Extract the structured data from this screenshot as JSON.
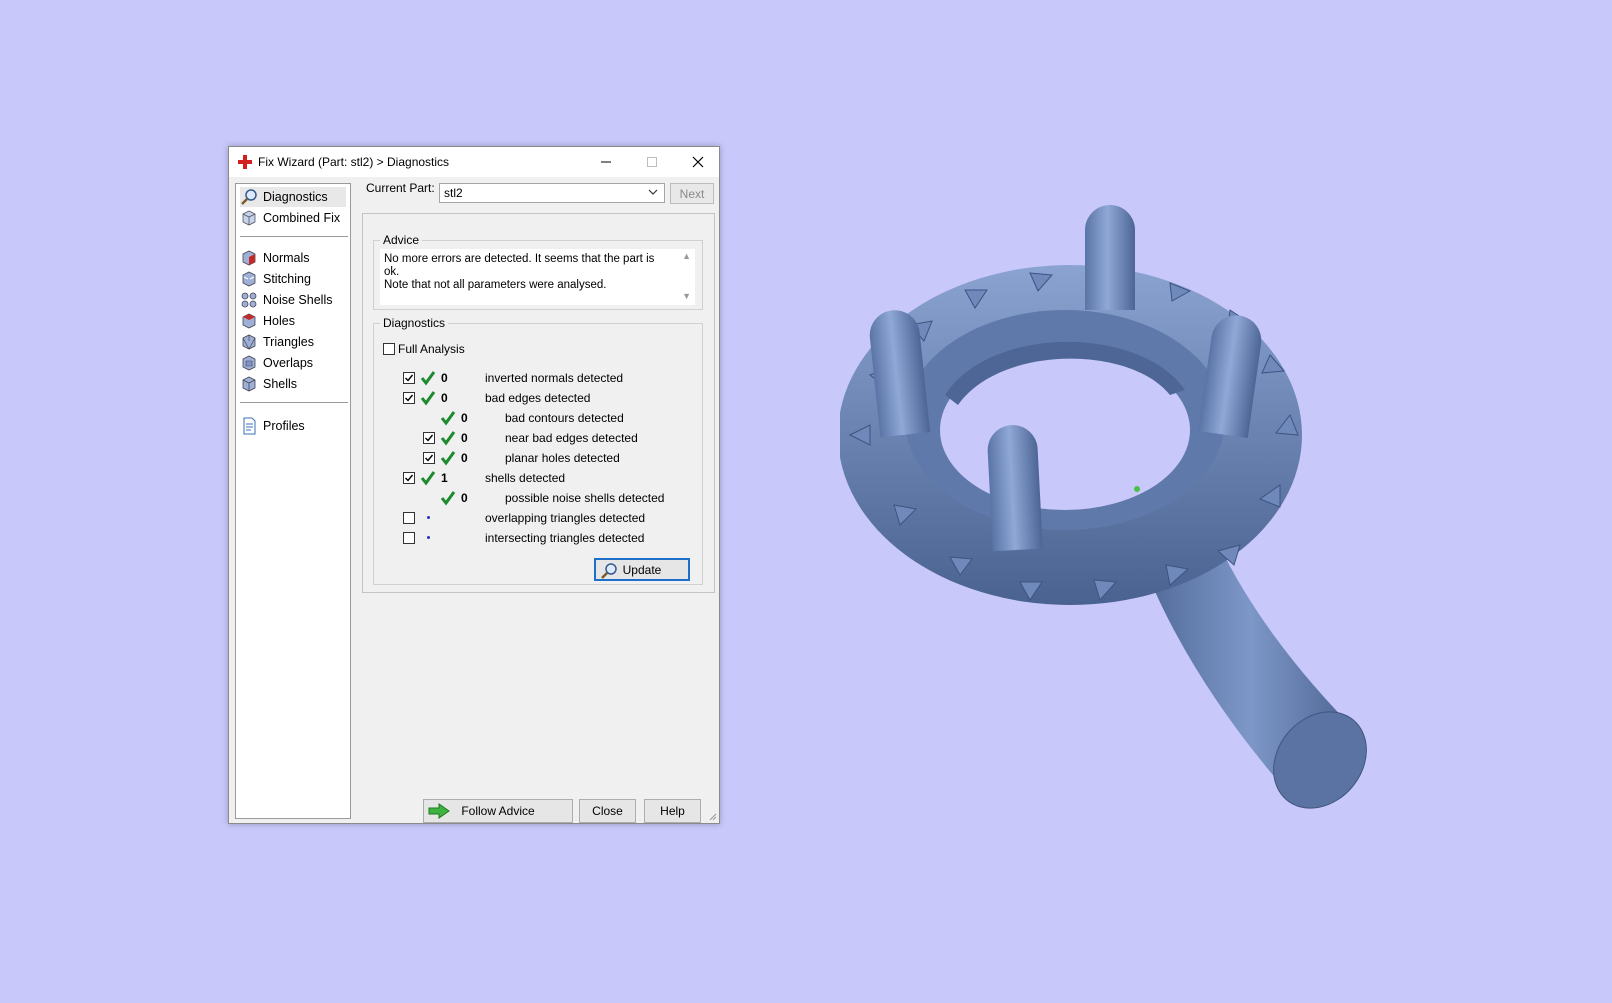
{
  "window": {
    "title": "Fix Wizard (Part: stl2) > Diagnostics"
  },
  "nav": {
    "items": [
      {
        "label": "Diagnostics",
        "icon": "magnifier-icon",
        "selected": true
      },
      {
        "label": "Combined Fix",
        "icon": "cube-icon"
      },
      {
        "label": "Normals",
        "icon": "normals-cube-icon"
      },
      {
        "label": "Stitching",
        "icon": "stitching-cube-icon"
      },
      {
        "label": "Noise Shells",
        "icon": "noise-shells-icon"
      },
      {
        "label": "Holes",
        "icon": "holes-cube-icon"
      },
      {
        "label": "Triangles",
        "icon": "triangles-cube-icon"
      },
      {
        "label": "Overlaps",
        "icon": "overlaps-cube-icon"
      },
      {
        "label": "Shells",
        "icon": "shells-cube-icon"
      },
      {
        "label": "Profiles",
        "icon": "document-icon"
      }
    ]
  },
  "current_part": {
    "label": "Current Part:",
    "value": "stl2",
    "next_label": "Next"
  },
  "advice": {
    "title": "Advice",
    "text": "No more errors are detected. It seems that the part is ok.\nNote that not all parameters were analysed."
  },
  "diagnostics": {
    "title": "Diagnostics",
    "full_analysis_label": "Full Analysis",
    "full_analysis_checked": false,
    "rows": [
      {
        "label": "inverted normals detected",
        "count": "0",
        "checked": true,
        "status": "ok"
      },
      {
        "label": "bad edges detected",
        "count": "0",
        "checked": true,
        "status": "ok"
      },
      {
        "label": "bad contours detected",
        "count": "0",
        "checked": null,
        "status": "ok"
      },
      {
        "label": "near bad edges detected",
        "count": "0",
        "checked": true,
        "status": "ok"
      },
      {
        "label": "planar holes detected",
        "count": "0",
        "checked": true,
        "status": "ok"
      },
      {
        "label": "shells detected",
        "count": "1",
        "checked": true,
        "status": "ok"
      },
      {
        "label": "possible noise shells detected",
        "count": "0",
        "checked": null,
        "status": "ok"
      },
      {
        "label": "overlapping triangles detected",
        "count": "",
        "checked": false,
        "status": "not-analysed"
      },
      {
        "label": "intersecting triangles detected",
        "count": "",
        "checked": false,
        "status": "not-analysed"
      }
    ],
    "update_label": "Update"
  },
  "buttons": {
    "follow_advice": "Follow Advice",
    "close": "Close",
    "help": "Help"
  },
  "colors": {
    "viewport_bg": "#c8c8fa",
    "model": "#6b86b8",
    "check_green": "#1e8a2e",
    "update_border": "#1e6fc8"
  }
}
